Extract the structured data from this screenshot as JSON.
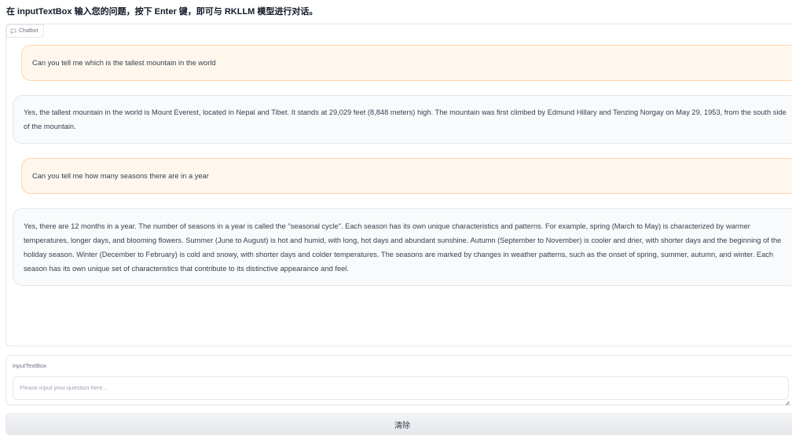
{
  "heading": "在 inputTextBox 输入您的问题，按下 Enter 键，即可与 RKLLM 模型进行对话。",
  "chatbot": {
    "label": "Chatbot",
    "icon": "chat-bubble-icon",
    "messages": [
      {
        "role": "user",
        "text": "Can you tell me which is the tallest mountain in the world"
      },
      {
        "role": "bot",
        "text": "Yes, the tallest mountain in the world is Mount Everest, located in Nepal and Tibet. It stands at 29,029 feet (8,848 meters) high. The mountain was first climbed by Edmund Hillary and Tenzing Norgay on May 29, 1953, from the south side of the mountain."
      },
      {
        "role": "user",
        "text": "Can you tell me how many seasons there are in a year"
      },
      {
        "role": "bot",
        "text": "Yes, there are 12 months in a year. The number of seasons in a year is called the \"seasonal cycle\". Each season has its own unique characteristics and patterns. For example, spring (March to May) is characterized by warmer temperatures, longer days, and blooming flowers. Summer (June to August) is hot and humid, with long, hot days and abundant sunshine. Autumn (September to November) is cooler and drier, with shorter days and the beginning of the holiday season. Winter (December to February) is cold and snowy, with shorter days and colder temperatures. The seasons are marked by changes in weather patterns, such as the onset of spring, summer, autumn, and winter. Each season has its own unique set of characteristics that contribute to its distinctive appearance and feel."
      }
    ]
  },
  "input": {
    "label": "inputTextBox",
    "value": "",
    "placeholder": "Please input your question here..."
  },
  "clear_button": {
    "label": "清除"
  },
  "colors": {
    "user_bubble": "#fff7ed",
    "user_border": "#fed7aa",
    "bot_bubble": "#f9fafb",
    "border": "#e5e7eb"
  }
}
